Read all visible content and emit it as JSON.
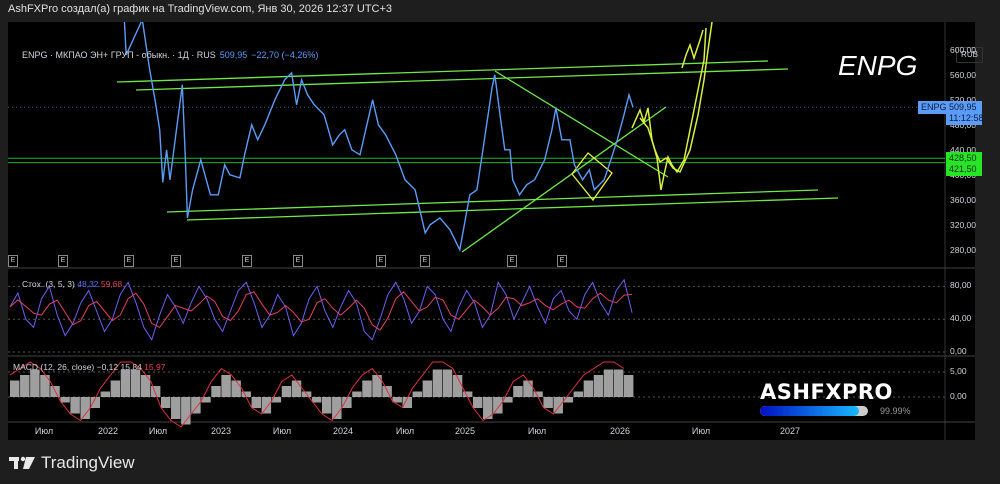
{
  "header": "AshFXPro создал(а) график на TradingView.com, Янв 30, 2026 12:37 UTC+3",
  "legend": {
    "symbol": "ENPG · МКПАО ЭН+ ГРУП - обыкн. · 1Д · RUS",
    "price": "509,95",
    "change": "−22,70 (−4,26%)"
  },
  "watermark": "ENPG",
  "currency": "RUB",
  "price_tag": {
    "symbol": "ENPG",
    "price": "509,95",
    "countdown": "11:12:58",
    "color": "#5b9cf6"
  },
  "level_tags": [
    {
      "price": "428,50"
    },
    {
      "price": "421,50"
    }
  ],
  "level_color": "#27e427",
  "stoch": {
    "label": "Стох. (3, 5, 3)",
    "k": "48,32",
    "d": "59,68",
    "ticks": [
      "80,00",
      "40,00",
      "0,00"
    ]
  },
  "macd": {
    "label": "MACD (12, 26, close)",
    "v1": "−0,12",
    "v2": "15,84",
    "v3": "15,97",
    "ticks": [
      "5,00",
      "0,00"
    ]
  },
  "earnings_marker": "E",
  "branding": {
    "name": "ASHFXPRO",
    "progress_percent": 99.99,
    "progress_label": "99.99%"
  },
  "footer_logo": "TradingView",
  "chart_data": {
    "type": "line",
    "series": [
      {
        "values": [
          [
            "2022-03-01",
            650
          ],
          [
            "2022-03-08",
            594
          ],
          [
            "2022-05-05",
            650
          ],
          [
            "2022-06-01",
            570
          ],
          [
            "2022-06-20",
            522
          ],
          [
            "2022-07-06",
            474
          ],
          [
            "2022-07-15",
            390
          ],
          [
            "2022-07-26",
            442
          ],
          [
            "2022-08-05",
            394
          ],
          [
            "2022-08-22",
            466
          ],
          [
            "2022-09-10",
            546
          ],
          [
            "2022-09-19",
            426
          ],
          [
            "2022-09-25",
            333
          ],
          [
            "2022-10-10",
            378
          ],
          [
            "2022-11-03",
            426
          ],
          [
            "2022-12-01",
            370
          ],
          [
            "2022-12-24",
            370
          ],
          [
            "2023-01-12",
            418
          ],
          [
            "2023-01-27",
            402
          ],
          [
            "2023-02-26",
            397
          ],
          [
            "2023-03-12",
            434
          ],
          [
            "2023-04-02",
            482
          ],
          [
            "2023-04-20",
            458
          ],
          [
            "2023-05-11",
            482
          ],
          [
            "2023-06-10",
            522
          ],
          [
            "2023-07-09",
            554
          ],
          [
            "2023-07-30",
            565
          ],
          [
            "2023-08-14",
            514
          ],
          [
            "2023-08-29",
            554
          ],
          [
            "2023-09-16",
            530
          ],
          [
            "2023-10-06",
            514
          ],
          [
            "2023-11-05",
            498
          ],
          [
            "2023-12-01",
            450
          ],
          [
            "2023-12-21",
            466
          ],
          [
            "2024-01-06",
            474
          ],
          [
            "2024-01-27",
            442
          ],
          [
            "2024-02-20",
            434
          ],
          [
            "2024-03-28",
            522
          ],
          [
            "2024-04-14",
            482
          ],
          [
            "2024-05-05",
            466
          ],
          [
            "2024-06-04",
            434
          ],
          [
            "2024-07-01",
            394
          ],
          [
            "2024-08-01",
            378
          ],
          [
            "2024-09-01",
            309
          ],
          [
            "2024-09-16",
            322
          ],
          [
            "2024-10-16",
            333
          ],
          [
            "2024-11-16",
            314
          ],
          [
            "2024-12-16",
            282
          ],
          [
            "2025-01-13",
            370
          ],
          [
            "2025-01-31",
            378
          ],
          [
            "2025-02-15",
            442
          ],
          [
            "2025-02-28",
            498
          ],
          [
            "2025-03-10",
            541
          ],
          [
            "2025-03-17",
            562
          ],
          [
            "2025-03-30",
            498
          ],
          [
            "2025-04-11",
            442
          ],
          [
            "2025-04-24",
            442
          ],
          [
            "2025-05-01",
            394
          ],
          [
            "2025-05-18",
            370
          ],
          [
            "2025-06-05",
            386
          ],
          [
            "2025-06-25",
            394
          ],
          [
            "2025-07-18",
            426
          ],
          [
            "2025-08-03",
            474
          ],
          [
            "2025-08-12",
            509
          ],
          [
            "2025-08-25",
            458
          ],
          [
            "2025-09-12",
            458
          ],
          [
            "2025-09-22",
            418
          ],
          [
            "2025-10-10",
            394
          ],
          [
            "2025-10-25",
            410
          ],
          [
            "2025-11-05",
            378
          ],
          [
            "2025-11-27",
            394
          ],
          [
            "2025-12-08",
            418
          ],
          [
            "2025-12-26",
            458
          ],
          [
            "2026-01-10",
            498
          ],
          [
            "2026-01-21",
            530
          ],
          [
            "2026-01-30",
            509.95
          ]
        ],
        "color": "#5b9cf6"
      }
    ],
    "y_ticks": [
      "600,00",
      "560,00",
      "520,00",
      "480,00",
      "440,00",
      "400,00",
      "360,00",
      "320,00",
      "280,00"
    ],
    "y_tick_values": [
      600,
      560,
      520,
      480,
      440,
      400,
      360,
      320,
      280
    ],
    "x_ticks": [
      {
        "label": "Июл",
        "date": "2021-07-01"
      },
      {
        "label": "2022",
        "date": "2022-01-01"
      },
      {
        "label": "Июл",
        "date": "2022-07-01"
      },
      {
        "label": "2023",
        "date": "2023-01-01"
      },
      {
        "label": "Июл",
        "date": "2023-07-01"
      },
      {
        "label": "2024",
        "date": "2024-01-01"
      },
      {
        "label": "Июл",
        "date": "2024-07-01"
      },
      {
        "label": "2025",
        "date": "2025-01-01"
      },
      {
        "label": "Июл",
        "date": "2025-07-01"
      },
      {
        "label": "2026",
        "date": "2026-01-01"
      },
      {
        "label": "Июл",
        "date": "2026-07-01"
      },
      {
        "label": "2027",
        "date": "2027-01-01"
      }
    ],
    "horizontal_levels": [
      428.5,
      421.5
    ],
    "stoch_k": [
      55,
      72,
      40,
      30,
      65,
      80,
      45,
      20,
      35,
      60,
      75,
      50,
      25,
      40,
      70,
      85,
      60,
      30,
      15,
      45,
      70,
      55,
      35,
      60,
      80,
      65,
      40,
      25,
      50,
      75,
      85,
      60,
      30,
      45,
      70,
      55,
      20,
      35,
      65,
      80,
      50,
      30,
      55,
      75,
      60,
      25,
      15,
      40,
      70,
      85,
      65,
      35,
      50,
      80,
      70,
      40,
      25,
      55,
      75,
      60,
      30,
      45,
      85,
      70,
      40,
      60,
      80,
      55,
      35,
      65,
      75,
      50,
      40,
      70,
      85,
      60,
      45,
      75,
      88,
      48
    ],
    "macd_hist": [
      3,
      4,
      5,
      4,
      2,
      -1,
      -3,
      -4,
      -2,
      1,
      3,
      5,
      5,
      4,
      2,
      -2,
      -4,
      -5,
      -3,
      -1,
      2,
      4,
      3,
      1,
      -2,
      -3,
      -1,
      2,
      3,
      1,
      -1,
      -3,
      -4,
      -2,
      1,
      3,
      4,
      2,
      -1,
      -2,
      1,
      3,
      5,
      5,
      4,
      1,
      -2,
      -4,
      -3,
      -1,
      2,
      3,
      1,
      -2,
      -3,
      -1,
      1,
      3,
      4,
      5,
      5,
      4
    ]
  }
}
